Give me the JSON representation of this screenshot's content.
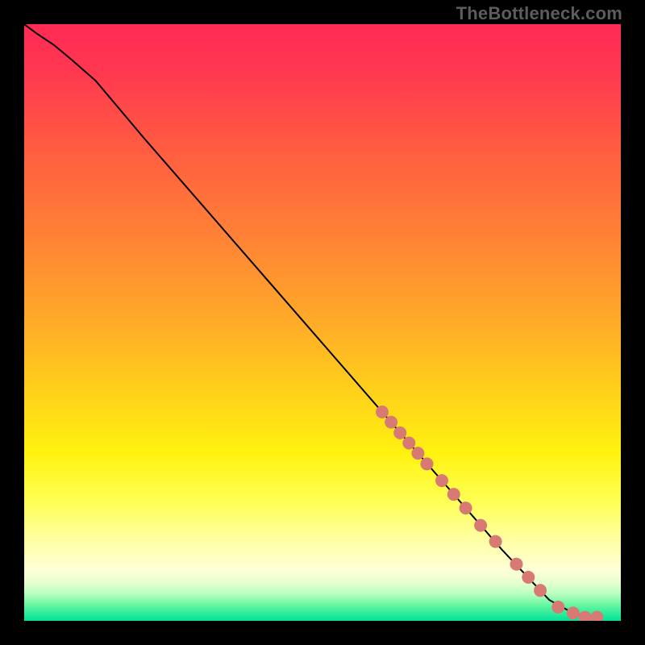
{
  "watermark": "TheBottleneck.com",
  "colors": {
    "bg_black": "#000000",
    "curve": "#000000",
    "dot_fill": "#d87a74",
    "dot_stroke": "#b85a54",
    "watermark_grey": "#5d5d5d"
  },
  "gradient_stops": [
    {
      "offset": 0.0,
      "color": "#ff2a55"
    },
    {
      "offset": 0.08,
      "color": "#ff3850"
    },
    {
      "offset": 0.2,
      "color": "#ff5a42"
    },
    {
      "offset": 0.35,
      "color": "#ff8036"
    },
    {
      "offset": 0.5,
      "color": "#ffab28"
    },
    {
      "offset": 0.62,
      "color": "#ffd21a"
    },
    {
      "offset": 0.72,
      "color": "#fff20f"
    },
    {
      "offset": 0.8,
      "color": "#ffff55"
    },
    {
      "offset": 0.87,
      "color": "#ffffaa"
    },
    {
      "offset": 0.915,
      "color": "#ffffd8"
    },
    {
      "offset": 0.935,
      "color": "#e8ffd0"
    },
    {
      "offset": 0.955,
      "color": "#b8ffc0"
    },
    {
      "offset": 0.975,
      "color": "#60f5a0"
    },
    {
      "offset": 1.0,
      "color": "#00e298"
    }
  ],
  "chart_data": {
    "type": "line",
    "title": "",
    "xlabel": "",
    "ylabel": "",
    "xlim": [
      0,
      100
    ],
    "ylim": [
      0,
      100
    ],
    "series": [
      {
        "name": "curve",
        "x": [
          0,
          2,
          5,
          8,
          12,
          20,
          30,
          40,
          50,
          60,
          70,
          80,
          88,
          92,
          95,
          96
        ],
        "y": [
          100,
          98.5,
          96.5,
          94,
          90.5,
          81,
          69.5,
          58,
          46.5,
          35,
          23.5,
          12,
          3.5,
          1.3,
          0.6,
          0.6
        ]
      }
    ],
    "dots": [
      {
        "x": 60.0,
        "y": 35.0
      },
      {
        "x": 61.5,
        "y": 33.3
      },
      {
        "x": 63.0,
        "y": 31.5
      },
      {
        "x": 64.5,
        "y": 29.8
      },
      {
        "x": 66.0,
        "y": 28.1
      },
      {
        "x": 67.5,
        "y": 26.3
      },
      {
        "x": 70.0,
        "y": 23.5
      },
      {
        "x": 72.0,
        "y": 21.2
      },
      {
        "x": 74.0,
        "y": 18.9
      },
      {
        "x": 76.5,
        "y": 16.0
      },
      {
        "x": 79.0,
        "y": 13.3
      },
      {
        "x": 82.5,
        "y": 9.5
      },
      {
        "x": 84.5,
        "y": 7.3
      },
      {
        "x": 86.5,
        "y": 5.1
      },
      {
        "x": 89.5,
        "y": 2.3
      },
      {
        "x": 92.0,
        "y": 1.3
      },
      {
        "x": 94.0,
        "y": 0.6
      },
      {
        "x": 96.0,
        "y": 0.6
      }
    ]
  }
}
